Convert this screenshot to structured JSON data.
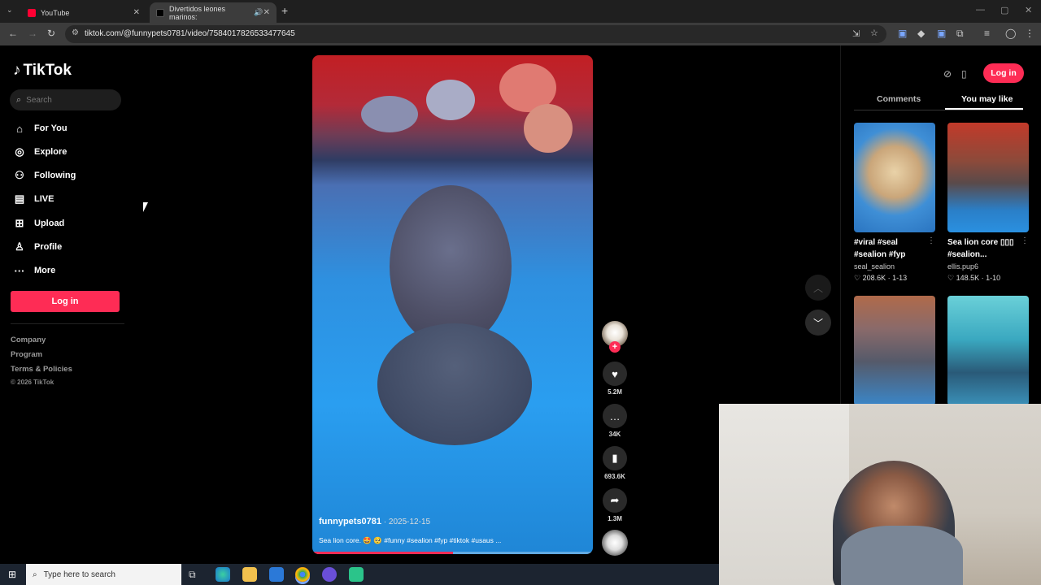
{
  "browser": {
    "tabs": [
      {
        "title": "YouTube",
        "favicon": "youtube-icon",
        "color": "#ff0033"
      },
      {
        "title": "Divertidos leones marinos: ",
        "favicon": "tiktok-icon",
        "active": true
      }
    ],
    "url": "tiktok.com/@funnypets0781/video/7584017826533477645"
  },
  "sidebar": {
    "logo": "TikTok",
    "search_placeholder": "Search",
    "nav": [
      {
        "label": "For You",
        "icon": "home-icon"
      },
      {
        "label": "Explore",
        "icon": "compass-icon"
      },
      {
        "label": "Following",
        "icon": "following-icon"
      },
      {
        "label": "LIVE",
        "icon": "live-icon"
      },
      {
        "label": "Upload",
        "icon": "upload-icon"
      },
      {
        "label": "Profile",
        "icon": "profile-icon"
      },
      {
        "label": "More",
        "icon": "more-icon"
      }
    ],
    "login": "Log in",
    "footer": [
      "Company",
      "Program",
      "Terms & Policies",
      "© 2026 TikTok"
    ]
  },
  "video": {
    "username": "funnypets0781",
    "date": " · 2025-12-15",
    "caption": "Sea lion core. 🤩 🥺 #funny #sealion #fyp #tiktok #usaus ...",
    "progress": 0.5,
    "likes": "5.2M",
    "comments": "34K",
    "saves": "693.6K",
    "shares": "1.3M"
  },
  "right_panel": {
    "login": "Log in",
    "tabs": [
      "Comments",
      "You may like"
    ],
    "active_tab": "You may like",
    "cards": [
      {
        "title": "#viral #seal #sealion #fyp",
        "user": "seal_sealion",
        "likes": "208.6K",
        "date": "1-13"
      },
      {
        "title": "Sea lion core ▯▯▯ #sealion...",
        "user": "ellis.pup6",
        "likes": "148.5K",
        "date": "1-10"
      }
    ]
  },
  "taskbar": {
    "search_placeholder": "Type here to search"
  },
  "colors": {
    "accent": "#fe2c55"
  }
}
